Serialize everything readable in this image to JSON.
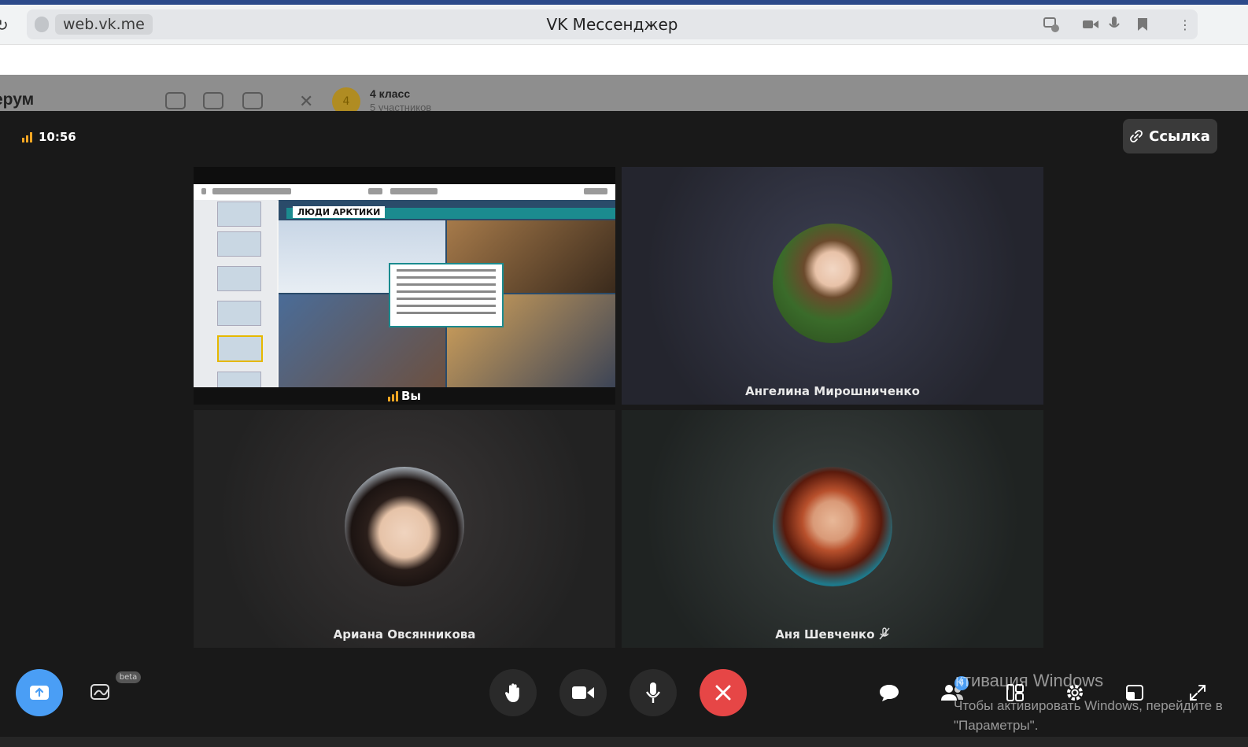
{
  "browser": {
    "url": "web.vk.me",
    "tab_title": "VK Мессенджер",
    "cast_count": "1"
  },
  "vk": {
    "sidebar_title": "ерум",
    "chat_name": "4 класс",
    "chat_avatar_letter": "4",
    "chat_subtitle": "5 участников"
  },
  "call": {
    "time": "10:56",
    "link_label": "Ссылка",
    "tiles": [
      {
        "name": "Вы",
        "type": "screen-share",
        "slide_title": "ЛЮДИ АРКТИКИ"
      },
      {
        "name": "Ангелина Мирошниченко",
        "type": "avatar"
      },
      {
        "name": "Ариана Овсянникова",
        "type": "avatar"
      },
      {
        "name": "Аня Шевченко",
        "type": "avatar",
        "muted": true
      }
    ],
    "controls": {
      "beta_label": "beta",
      "participants_badge": "4"
    },
    "colors": {
      "accent_orange": "#f5a623",
      "end_call_red": "#e64646",
      "share_blue": "#4a9ef5"
    }
  },
  "watermark": {
    "line1": "ктивация Windows",
    "line2": "Чтобы активировать Windows, перейдите в",
    "line3": "\"Параметры\"."
  }
}
